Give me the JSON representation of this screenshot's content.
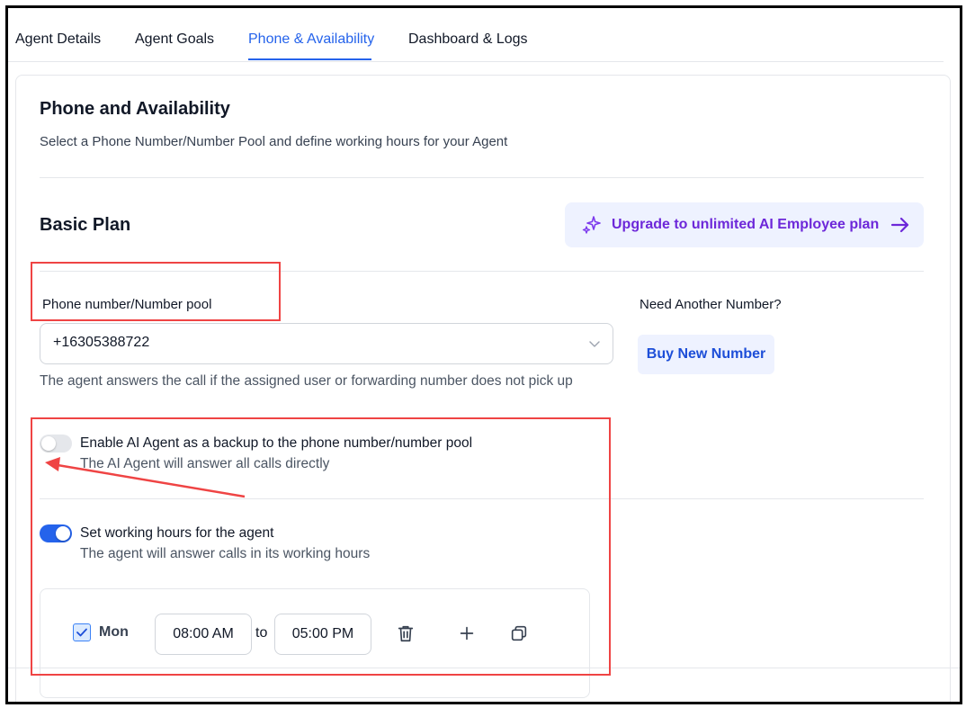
{
  "tabs": [
    {
      "label": "Agent Details",
      "active": false
    },
    {
      "label": "Agent Goals",
      "active": false
    },
    {
      "label": "Phone & Availability",
      "active": true
    },
    {
      "label": "Dashboard & Logs",
      "active": false
    }
  ],
  "section": {
    "title": "Phone and Availability",
    "subtitle": "Select a Phone Number/Number Pool and define working hours for your Agent"
  },
  "plan": {
    "name": "Basic Plan",
    "upgrade_label": "Upgrade to unlimited AI Employee plan",
    "upgrade_icon": "sparkle-icon",
    "upgrade_arrow_icon": "arrow-right-icon"
  },
  "phone": {
    "label": "Phone number/Number pool",
    "selected": "+16305388722",
    "help": "The agent answers the call if the assigned user or forwarding number does not pick up"
  },
  "need_number": {
    "label": "Need Another Number?",
    "button_label": "Buy New Number"
  },
  "backup": {
    "enabled": false,
    "title": "Enable AI Agent as a backup to the phone number/number pool",
    "description": "The AI Agent will answer all calls directly"
  },
  "working_hours": {
    "enabled": true,
    "title": "Set working hours for the agent",
    "description": "The agent will answer calls in its working hours",
    "days": [
      {
        "day": "Mon",
        "checked": true,
        "from": "08:00 AM",
        "to_label": "to",
        "to": "05:00 PM"
      }
    ]
  },
  "colors": {
    "accent": "#2563eb",
    "upgrade_text": "#6d28d9",
    "annotation": "#ef4444"
  }
}
